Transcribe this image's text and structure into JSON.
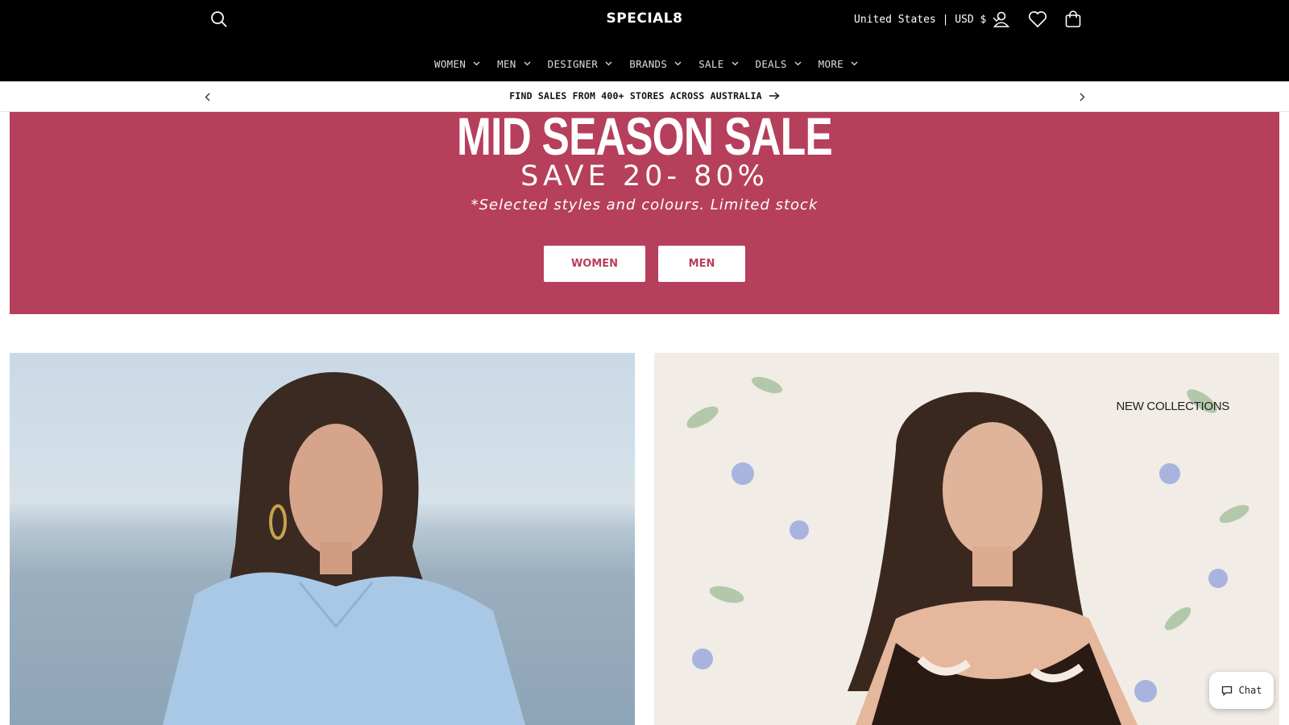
{
  "header": {
    "logo": "SPECIAL8",
    "locale": "United States | USD $",
    "icons": [
      "search-icon",
      "account-icon",
      "wishlist-heart-icon",
      "cart-bag-icon"
    ]
  },
  "nav": {
    "items": [
      {
        "label": "WOMEN"
      },
      {
        "label": "MEN"
      },
      {
        "label": "DESIGNER"
      },
      {
        "label": "BRANDS"
      },
      {
        "label": "SALE"
      },
      {
        "label": "DEALS"
      },
      {
        "label": "MORE"
      }
    ]
  },
  "announcement": {
    "text": "FIND SALES FROM 400+ STORES ACROSS AUSTRALIA"
  },
  "hero": {
    "title": "MID SEASON SALE",
    "subtitle": "SAVE 20- 80%",
    "note": "*Selected styles and colours. Limited stock",
    "buttons": {
      "women": "WOMEN",
      "men": "MEN"
    },
    "background_color": "#b63f5c"
  },
  "tiles": {
    "right_label": "NEW COLLECTIONS"
  },
  "chat": {
    "label": "Chat"
  }
}
